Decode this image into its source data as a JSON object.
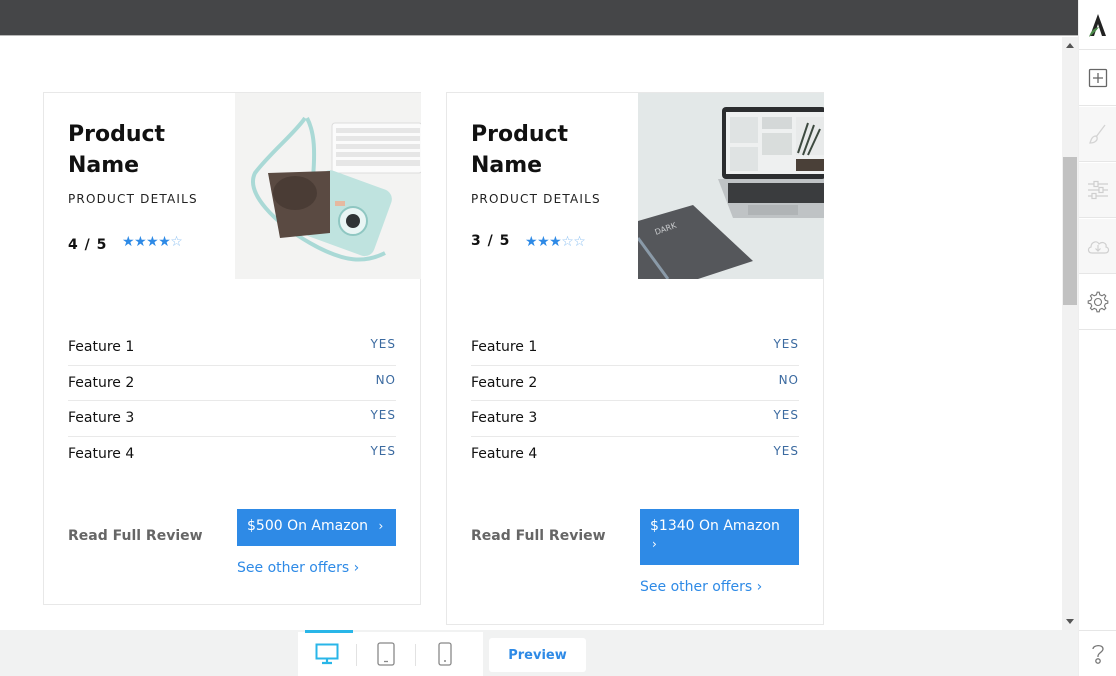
{
  "toolbar": {
    "preview_label": "Preview",
    "devices": [
      "desktop",
      "tablet",
      "mobile"
    ],
    "active_device": "desktop"
  },
  "sidebar": {
    "items": [
      {
        "name": "logo",
        "icon": "brand-logo-icon"
      },
      {
        "name": "add",
        "icon": "plus-square-icon"
      },
      {
        "name": "style",
        "icon": "brush-icon",
        "disabled": true
      },
      {
        "name": "adjust",
        "icon": "sliders-icon",
        "disabled": true
      },
      {
        "name": "download",
        "icon": "cloud-download-icon",
        "disabled": true
      },
      {
        "name": "settings",
        "icon": "gear-icon"
      },
      {
        "name": "help",
        "icon": "question-icon"
      }
    ]
  },
  "colors": {
    "accent": "#2e8ae6",
    "topbar": "#454648",
    "feature_value": "#3b6aa0",
    "device_active": "#29b6e8"
  },
  "cards": [
    {
      "title": "Product Name",
      "details": "PRODUCT DETAILS",
      "score": "4 / 5",
      "rating": 4,
      "rating_max": 5,
      "image": "instant camera and keyboard photo",
      "features": [
        {
          "name": "Feature 1",
          "value": "YES"
        },
        {
          "name": "Feature 2",
          "value": "NO"
        },
        {
          "name": "Feature 3",
          "value": "YES"
        },
        {
          "name": "Feature 4",
          "value": "YES"
        }
      ],
      "read_review": "Read Full Review",
      "buy_label": "$500 On Amazon",
      "buy_chevron": "›",
      "offers": "See other offers ›"
    },
    {
      "title": "Product Name",
      "details": "PRODUCT DETAILS",
      "score": "3 / 5",
      "rating": 3,
      "rating_max": 5,
      "image": "laptop and notebook photo",
      "features": [
        {
          "name": "Feature 1",
          "value": "YES"
        },
        {
          "name": "Feature 2",
          "value": "NO"
        },
        {
          "name": "Feature 3",
          "value": "YES"
        },
        {
          "name": "Feature 4",
          "value": "YES"
        }
      ],
      "read_review": "Read Full Review",
      "buy_label": "$1340 On Amazon",
      "buy_chevron": "›",
      "offers": "See other offers ›"
    }
  ]
}
